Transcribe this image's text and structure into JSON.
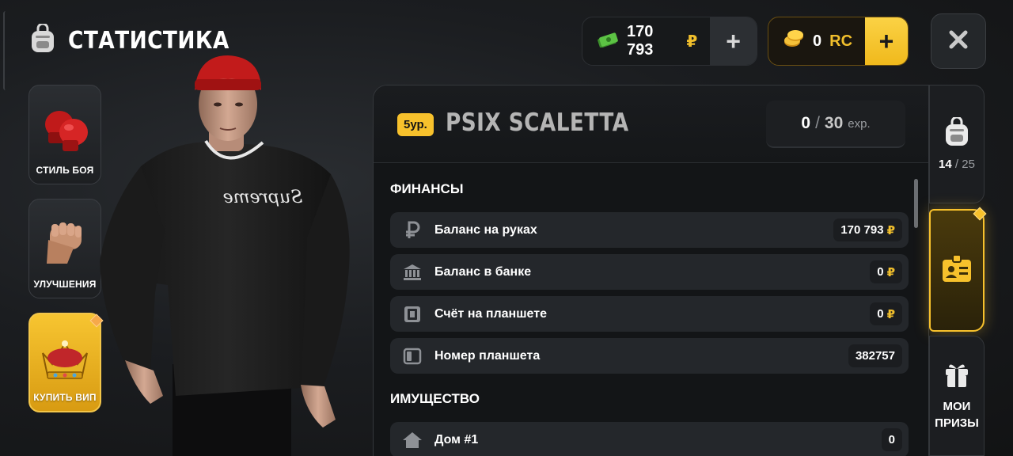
{
  "header": {
    "title": "СТАТИСТИКА",
    "icon": "backpack-icon"
  },
  "menu": [
    {
      "label": "СТИЛЬ БОЯ",
      "icon": "boxing-gloves-icon"
    },
    {
      "label": "УЛУЧШЕНИЯ",
      "icon": "fist-icon"
    },
    {
      "label": "КУПИТЬ ВИП",
      "icon": "crown-icon"
    }
  ],
  "currency": {
    "cash_value": "170 793",
    "cash_symbol": "₽",
    "rc_value": "0",
    "rc_symbol": "RC",
    "plus_symbol": "+"
  },
  "player": {
    "level_label": "5ур.",
    "name": "PSIX SCALETTA",
    "exp_current": "0",
    "exp_sep": "/",
    "exp_total": "30",
    "exp_unit": "exp."
  },
  "finance": {
    "title": "ФИНАНСЫ",
    "rows": [
      {
        "label": "Баланс на руках",
        "value": "170 793",
        "currency": "₽",
        "icon": "ruble-icon"
      },
      {
        "label": "Баланс в банке",
        "value": "0",
        "currency": "₽",
        "icon": "bank-icon"
      },
      {
        "label": "Счёт на планшете",
        "value": "0",
        "currency": "₽",
        "icon": "tablet-account-icon"
      },
      {
        "label": "Номер планшета",
        "value": "382757",
        "currency": "",
        "icon": "tablet-icon"
      }
    ]
  },
  "property": {
    "title": "ИМУЩЕСТВО",
    "rows": [
      {
        "label": "Дом #1",
        "value": "0",
        "icon": "house-icon"
      }
    ]
  },
  "side_tabs": {
    "inventory": {
      "count": "14",
      "sep": "/",
      "total": "25",
      "icon": "backpack-icon"
    },
    "stats": {
      "icon": "id-card-icon"
    },
    "prizes": {
      "label_line1": "МОИ",
      "label_line2": "ПРИЗЫ",
      "icon": "gift-icon"
    }
  },
  "colors": {
    "accent": "#f7c12c",
    "panel": "#131517",
    "row": "#24272b"
  }
}
